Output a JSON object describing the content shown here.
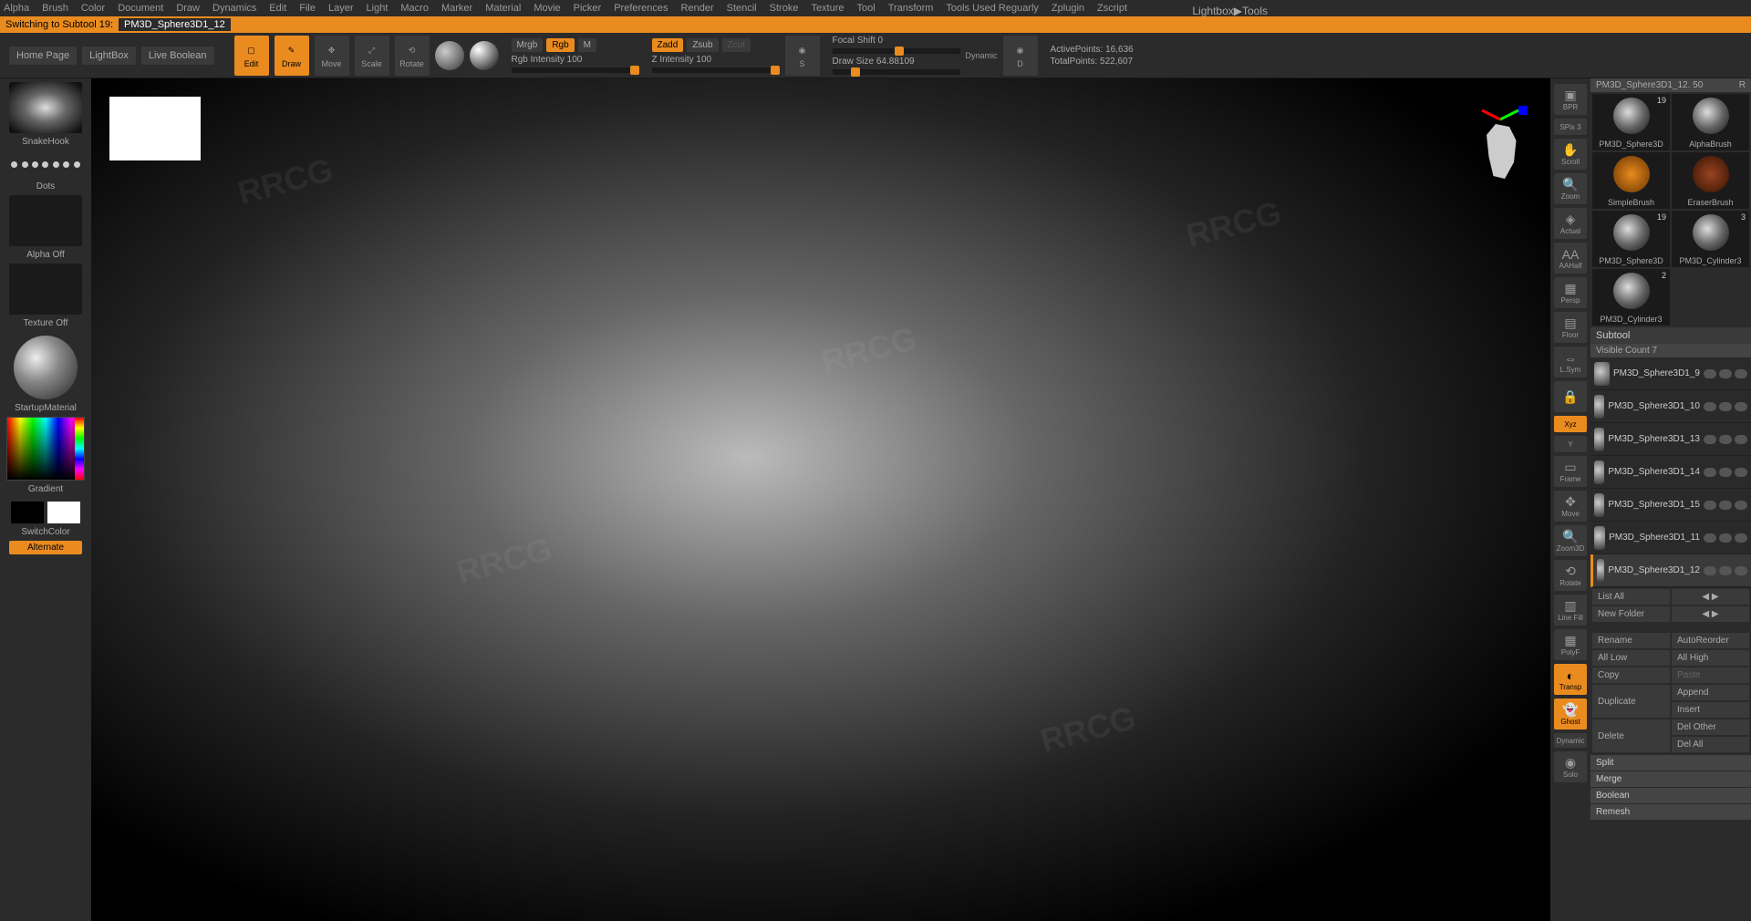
{
  "menu": [
    "Alpha",
    "Brush",
    "Color",
    "Document",
    "Draw",
    "Dynamics",
    "Edit",
    "File",
    "Layer",
    "Light",
    "Macro",
    "Marker",
    "Material",
    "Movie",
    "Picker",
    "Preferences",
    "Render",
    "Stencil",
    "Stroke",
    "Texture",
    "Tool",
    "Transform",
    "Tools Used Reguarly",
    "Zplugin",
    "Zscript"
  ],
  "status": {
    "msg": "Switching to Subtool 19:",
    "tool": "PM3D_Sphere3D1_12",
    "lightbox": "Lightbox▶Tools"
  },
  "topbar": {
    "home": "Home Page",
    "lightbox": "LightBox",
    "liveboolean": "Live Boolean",
    "edit": "Edit",
    "draw": "Draw",
    "move": "Move",
    "scale": "Scale",
    "rotate": "Rotate",
    "mrgb": "Mrgb",
    "rgb": "Rgb",
    "m": "M",
    "rgbint": "Rgb Intensity 100",
    "zadd": "Zadd",
    "zsub": "Zsub",
    "zcut": "Zcut",
    "zint": "Z Intensity 100",
    "focal": "Focal Shift 0",
    "drawsize": "Draw Size 64.88109",
    "dynamic": "Dynamic",
    "activep": "ActivePoints: 16,636",
    "totalp": "TotalPoints: 522,607"
  },
  "left": {
    "brush": "SnakeHook",
    "stroke": "Dots",
    "alpha": "Alpha Off",
    "texture": "Texture Off",
    "material": "StartupMaterial",
    "gradient": "Gradient",
    "switch": "SwitchColor",
    "alternate": "Alternate"
  },
  "rtool": {
    "bpr": "BPR",
    "spix": "SPix 3",
    "scroll": "Scroll",
    "zoom": "Zoom",
    "actual": "Actual",
    "aahalf": "AAHalf",
    "persp": "Persp",
    "floor": "Floor",
    "lsym": "L.Sym",
    "lock": "",
    "xyz": "Xyz",
    "y": "Y",
    "frame": "Frame",
    "move": "Move",
    "zoom3d": "Zoom3D",
    "rotate": "Rotate",
    "linefill": "Line Fill",
    "polyf": "PolyF",
    "transp": "Transp",
    "ghost": "Ghost",
    "dynamic": "Dynamic",
    "solo": "Solo"
  },
  "rp": {
    "title": "PM3D_Sphere3D1_12. 50",
    "r": "R",
    "tools": [
      {
        "name": "PM3D_Sphere3D",
        "count": "19"
      },
      {
        "name": "AlphaBrush",
        "count": ""
      },
      {
        "name": "SimpleBrush",
        "count": ""
      },
      {
        "name": "EraserBrush",
        "count": ""
      },
      {
        "name": "PM3D_Sphere3D",
        "count": "19"
      },
      {
        "name": "PM3D_Cylinder3",
        "count": "3"
      },
      {
        "name": "PM3D_Cylinder3",
        "count": "2"
      }
    ],
    "subtool": "Subtool",
    "visible": "Visible Count 7",
    "items": [
      "PM3D_Sphere3D1_9",
      "PM3D_Sphere3D1_10",
      "PM3D_Sphere3D1_13",
      "PM3D_Sphere3D1_14",
      "PM3D_Sphere3D1_15",
      "PM3D_Sphere3D1_11",
      "PM3D_Sphere3D1_12"
    ],
    "listall": "List All",
    "newfolder": "New Folder",
    "rename": "Rename",
    "autoreorder": "AutoReorder",
    "alllow": "All Low",
    "allhigh": "All High",
    "copy": "Copy",
    "paste": "Paste",
    "duplicate": "Duplicate",
    "append": "Append",
    "insert": "Insert",
    "delete": "Delete",
    "delother": "Del Other",
    "delall": "Del All",
    "split": "Split",
    "merge": "Merge",
    "boolean": "Boolean",
    "remesh": "Remesh"
  },
  "watermark": "RRCG"
}
